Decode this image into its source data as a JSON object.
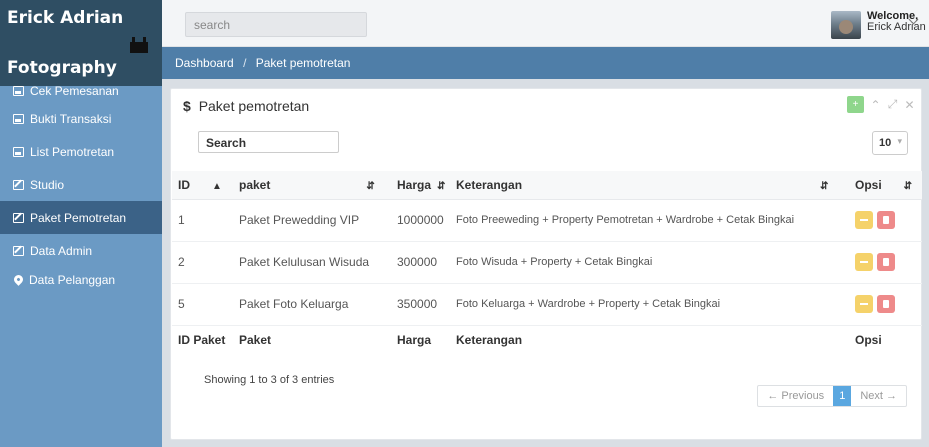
{
  "brand": {
    "line1": "Erick Adrian",
    "line2": "Fotography",
    "icon": "robot-icon"
  },
  "sidebar": {
    "items": [
      {
        "label": "Cek Pemesanan",
        "icon": "image-icon"
      },
      {
        "label": "Bukti Transaksi",
        "icon": "image-icon"
      },
      {
        "label": "List Pemotretan",
        "icon": "image-icon"
      },
      {
        "label": "Studio",
        "icon": "edit-icon"
      },
      {
        "label": "Paket Pemotretan",
        "icon": "edit-icon",
        "active": true
      },
      {
        "label": "Data Admin",
        "icon": "edit-icon"
      },
      {
        "label": "Data Pelanggan",
        "icon": "map-marker-icon"
      }
    ]
  },
  "topbar": {
    "search_placeholder": "search",
    "welcome": "Welcome,",
    "user": "Erick Adrian"
  },
  "breadcrumb": {
    "home": "Dashboard",
    "separator": "/",
    "current": "Paket pemotretan"
  },
  "panel": {
    "title": "Paket pemotretan",
    "title_icon": "$",
    "add_label": "+",
    "search_label": "Search",
    "page_length": "10",
    "columns": [
      "ID",
      "paket",
      "Harga",
      "Keterangan",
      "Opsi"
    ],
    "footer_columns": [
      "ID Paket",
      "Paket",
      "Harga",
      "Keterangan",
      "Opsi"
    ],
    "rows": [
      {
        "id": "1",
        "paket": "Paket Prewedding VIP",
        "harga": "1000000",
        "keterangan": "Foto Preeweding +  Property Pemotretan + Wardrobe + Cetak Bingkai"
      },
      {
        "id": "2",
        "paket": "Paket Kelulusan Wisuda",
        "harga": "300000",
        "keterangan": "Foto Wisuda + Property + Cetak Bingkai"
      },
      {
        "id": "5",
        "paket": "Paket Foto Keluarga",
        "harga": "350000",
        "keterangan": "Foto Keluarga + Wardrobe + Property + Cetak Bingkai"
      }
    ],
    "info": "Showing 1 to 3 of 3 entries",
    "pagination": {
      "previous": "← Previous",
      "current": "1",
      "next": "Next →"
    }
  },
  "colors": {
    "sidebar": "#6b9ac4",
    "brand_bg": "#2f4e63",
    "active": "#3b6287",
    "crumbbar": "#4f7ea8",
    "keterangan": "#f2c94c"
  }
}
